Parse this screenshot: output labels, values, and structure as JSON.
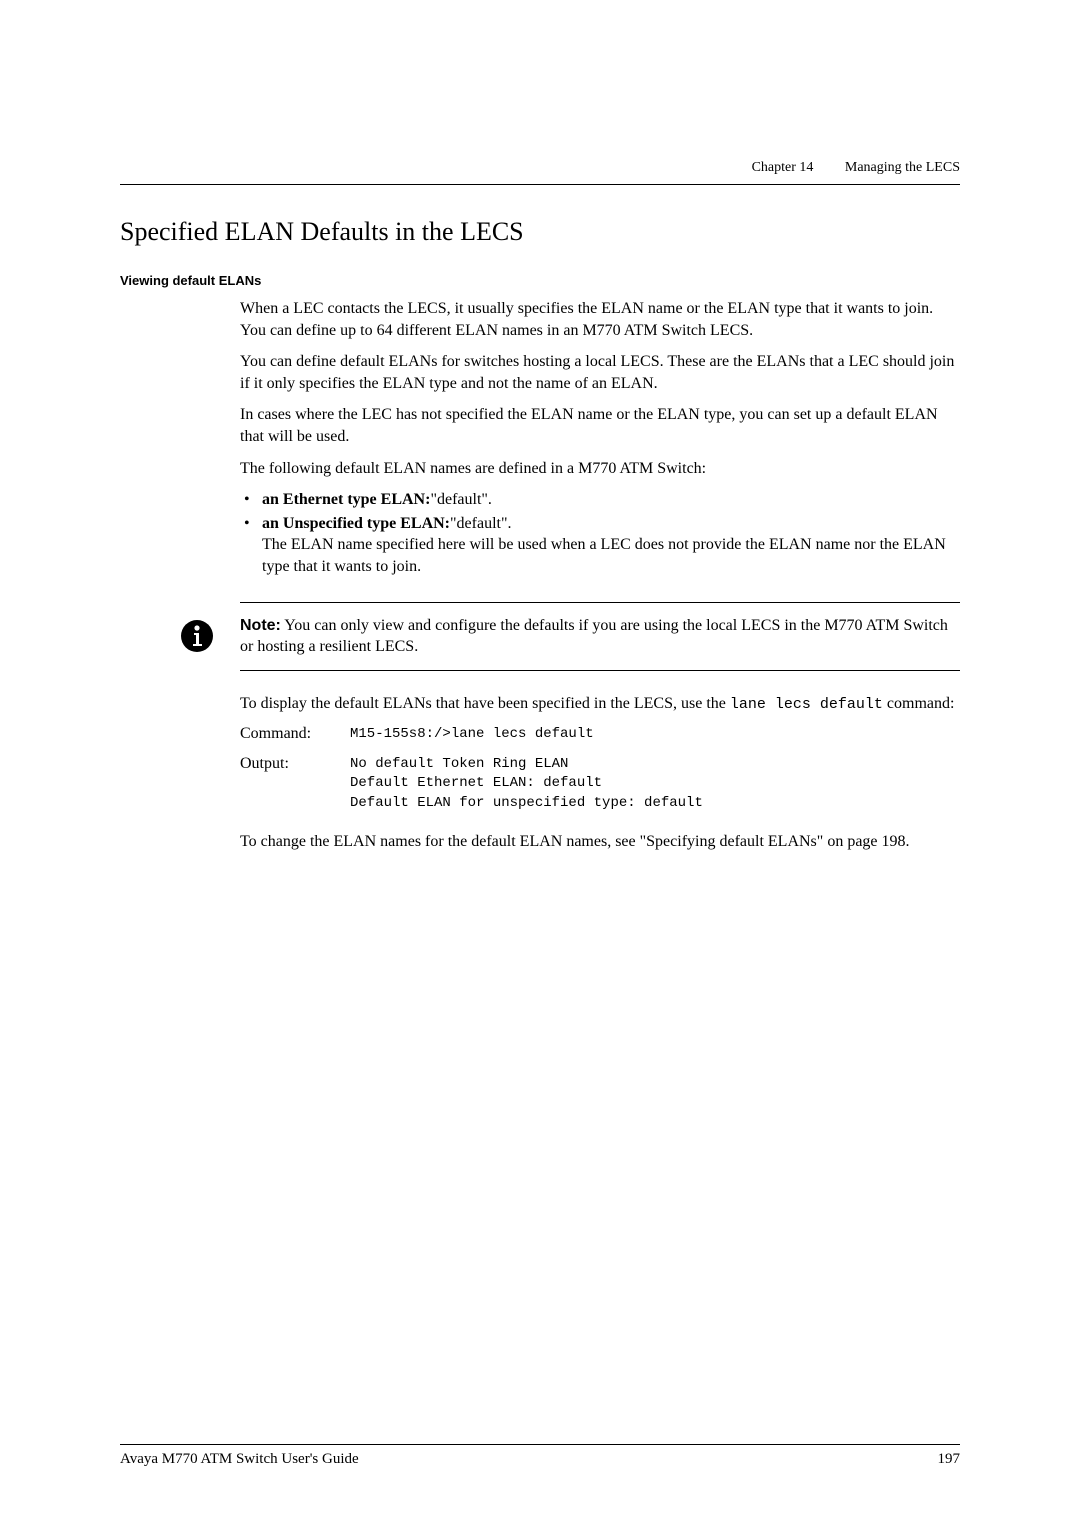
{
  "header": {
    "chapter": "Chapter 14",
    "title": "Managing the LECS"
  },
  "section": {
    "title": "Specified ELAN Defaults in the LECS"
  },
  "subsection": {
    "title": "Viewing default ELANs"
  },
  "body": {
    "p1": "When a LEC contacts the LECS, it usually specifies the ELAN name or the ELAN type that it wants to join. You can define up to 64 different ELAN names in an M770 ATM Switch LECS.",
    "p2": "You can define default ELANs for switches hosting a local LECS. These are the ELANs that a LEC should join if it only specifies the ELAN type and not the name of an ELAN.",
    "p3": "In cases where the LEC has not specified the ELAN name or the ELAN type, you can set up a default ELAN that will be used.",
    "p4": "The following default ELAN names are defined in a M770 ATM Switch:",
    "b1_bold": "an Ethernet type ELAN:",
    "b1_tail": "\"default\".",
    "b2_bold": "an Unspecified type ELAN:",
    "b2_tail": "\"default\".",
    "b2_sub": "The ELAN name specified here will be used when a LEC does not provide the ELAN name nor the ELAN type that it wants to join."
  },
  "note": {
    "label": "Note:",
    "text": "  You can only view and configure the defaults if you are using the local LECS in the M770 ATM Switch or hosting a resilient LECS."
  },
  "after_note": {
    "p1a": "To display the default ELANs that have been specified in the LECS, use the ",
    "code1": "lane lecs default",
    "p1b": " command:"
  },
  "cmd": {
    "command_label": "Command:",
    "command_value": "M15-155s8:/>lane lecs default",
    "output_label": "Output:",
    "output_value": "No default Token Ring ELAN\nDefault Ethernet ELAN: default\nDefault ELAN for unspecified type: default"
  },
  "tail": {
    "p1": "To change the ELAN names for the default ELAN names, see \"Specifying default ELANs\" on page 198."
  },
  "footer": {
    "left": "Avaya M770 ATM Switch User's Guide",
    "right": "197"
  }
}
